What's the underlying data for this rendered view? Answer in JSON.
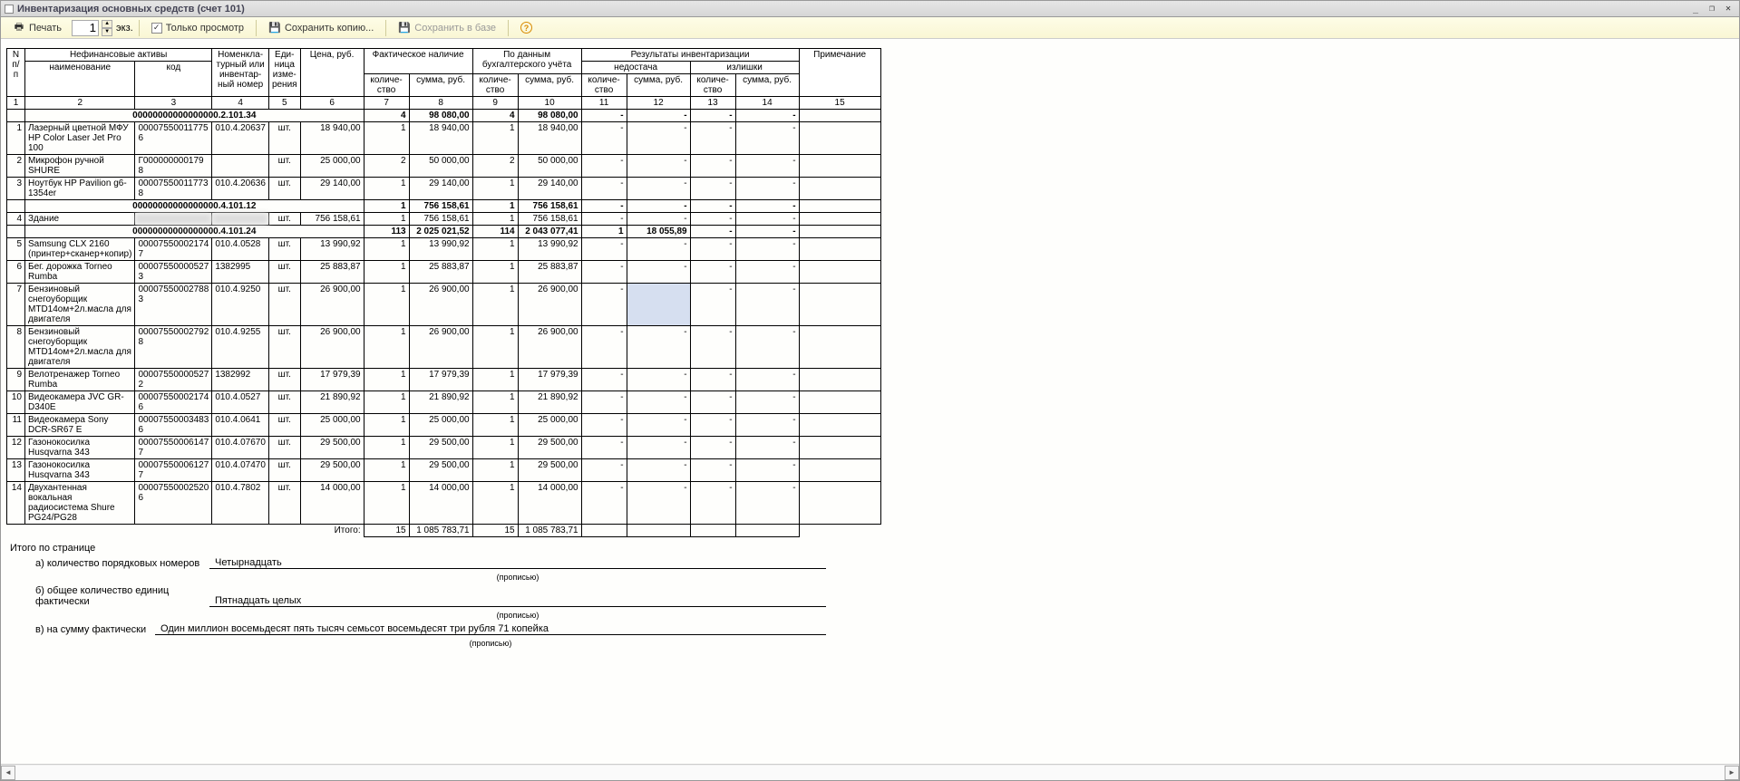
{
  "window": {
    "title": "Инвентаризация основных средств (счет 101)"
  },
  "toolbar": {
    "print": "Печать",
    "copies": "1",
    "copies_suffix": "экз.",
    "readonly": "Только просмотр",
    "readonly_checked": "✓",
    "save_copy": "Сохранить копию...",
    "save_db": "Сохранить в базе"
  },
  "headers": {
    "npp": "N п/п",
    "nfa": "Нефинансовые активы",
    "name": "наименование",
    "code": "код",
    "nomen": "Номенкла-\nтурный или инвентар-\nный номер",
    "unit": "Еди-\nница изме-\nрения",
    "price": "Цена, руб.",
    "fact": "Фактическое наличие",
    "book": "По данным бухгалтерского учёта",
    "result": "Результаты инвентаризации",
    "shortage": "недостача",
    "surplus": "излишки",
    "qty": "количе-\nство",
    "sum": "сумма, руб.",
    "note": "Примечание"
  },
  "colnums": [
    "1",
    "2",
    "3",
    "4",
    "5",
    "6",
    "7",
    "8",
    "9",
    "10",
    "11",
    "12",
    "13",
    "14",
    "15"
  ],
  "groups": [
    {
      "code": "00000000000000000.2.101.34",
      "fqty": "4",
      "fsum": "98 080,00",
      "bqty": "4",
      "bsum": "98 080,00",
      "rows": [
        {
          "n": "1",
          "name": "Лазерный цветной МФУ HP Color Laser Jet Pro 100",
          "code": "00007550011775 6",
          "inv": "010.4.20637",
          "unit": "шт.",
          "price": "18 940,00",
          "fq": "1",
          "fs": "18 940,00",
          "bq": "1",
          "bs": "18 940,00"
        },
        {
          "n": "2",
          "name": "Микрофон ручной SHURE",
          "code": "Г000000000179 8",
          "inv": "",
          "unit": "шт.",
          "price": "25 000,00",
          "fq": "2",
          "fs": "50 000,00",
          "bq": "2",
          "bs": "50 000,00"
        },
        {
          "n": "3",
          "name": "Ноутбук HP Pavilion g6-1354er",
          "code": "00007550011773 8",
          "inv": "010.4.20636",
          "unit": "шт.",
          "price": "29 140,00",
          "fq": "1",
          "fs": "29 140,00",
          "bq": "1",
          "bs": "29 140,00"
        }
      ]
    },
    {
      "code": "00000000000000000.4.101.12",
      "fqty": "1",
      "fsum": "756 158,61",
      "bqty": "1",
      "bsum": "756 158,61",
      "rows": [
        {
          "n": "4",
          "name": "Здание",
          "code": "",
          "inv": "",
          "unit": "шт.",
          "price": "756 158,61",
          "fq": "1",
          "fs": "756 158,61",
          "bq": "1",
          "bs": "756 158,61",
          "blur": true
        }
      ]
    },
    {
      "code": "00000000000000000.4.101.24",
      "fqty": "113",
      "fsum": "2 025 021,52",
      "bqty": "114",
      "bsum": "2 043 077,41",
      "shq": "1",
      "shs": "18 055,89",
      "rows": [
        {
          "n": "5",
          "name": "Samsung CLX 2160 (принтер+сканер+копир)",
          "code": "00007550002174 7",
          "inv": "010.4.0528",
          "unit": "шт.",
          "price": "13 990,92",
          "fq": "1",
          "fs": "13 990,92",
          "bq": "1",
          "bs": "13 990,92"
        },
        {
          "n": "6",
          "name": "Бег. дорожка Torneo Rumba",
          "code": "00007550000527 3",
          "inv": "1382995",
          "unit": "шт.",
          "price": "25 883,87",
          "fq": "1",
          "fs": "25 883,87",
          "bq": "1",
          "bs": "25 883,87"
        },
        {
          "n": "7",
          "name": "Бензиновый снегоуборщик MTD14ом+2л.масла для двигателя",
          "code": "00007550002788 3",
          "inv": "010.4.9250",
          "unit": "шт.",
          "price": "26 900,00",
          "fq": "1",
          "fs": "26 900,00",
          "bq": "1",
          "bs": "26 900,00",
          "sel": true
        },
        {
          "n": "8",
          "name": "Бензиновый снегоуборщик MTD14ом+2л.масла для двигателя",
          "code": "00007550002792 8",
          "inv": "010.4.9255",
          "unit": "шт.",
          "price": "26 900,00",
          "fq": "1",
          "fs": "26 900,00",
          "bq": "1",
          "bs": "26 900,00"
        },
        {
          "n": "9",
          "name": "Велотренажер Torneo Rumba",
          "code": "00007550000527 2",
          "inv": "1382992",
          "unit": "шт.",
          "price": "17 979,39",
          "fq": "1",
          "fs": "17 979,39",
          "bq": "1",
          "bs": "17 979,39"
        },
        {
          "n": "10",
          "name": "Видеокамера JVC GR-D340E",
          "code": "00007550002174 6",
          "inv": "010.4.0527",
          "unit": "шт.",
          "price": "21 890,92",
          "fq": "1",
          "fs": "21 890,92",
          "bq": "1",
          "bs": "21 890,92"
        },
        {
          "n": "11",
          "name": "Видеокамера Sony DCR-SR67 E",
          "code": "00007550003483 6",
          "inv": "010.4.0641",
          "unit": "шт.",
          "price": "25 000,00",
          "fq": "1",
          "fs": "25 000,00",
          "bq": "1",
          "bs": "25 000,00"
        },
        {
          "n": "12",
          "name": "Газонокосилка Husqvarna 343",
          "code": "00007550006147 7",
          "inv": "010.4.07670",
          "unit": "шт.",
          "price": "29 500,00",
          "fq": "1",
          "fs": "29 500,00",
          "bq": "1",
          "bs": "29 500,00"
        },
        {
          "n": "13",
          "name": "Газонокосилка Husqvarna 343",
          "code": "00007550006127 7",
          "inv": "010.4.07470",
          "unit": "шт.",
          "price": "29 500,00",
          "fq": "1",
          "fs": "29 500,00",
          "bq": "1",
          "bs": "29 500,00"
        },
        {
          "n": "14",
          "name": "Двухантенная вокальная радиосистема Shure PG24/PG28",
          "code": "00007550002520 6",
          "inv": "010.4.7802",
          "unit": "шт.",
          "price": "14 000,00",
          "fq": "1",
          "fs": "14 000,00",
          "bq": "1",
          "bs": "14 000,00"
        }
      ]
    }
  ],
  "totals": {
    "label": "Итого:",
    "fq": "15",
    "fs": "1 085 783,71",
    "bq": "15",
    "bs": "1 085 783,71"
  },
  "page_footer": {
    "title": "Итого по странице",
    "a_lbl": "а) количество порядковых номеров",
    "a_val": "Четырнадцать",
    "b_lbl": "б) общее количество единиц фактически",
    "b_val": "Пятнадцать целых",
    "v_lbl": "в) на сумму фактически",
    "v_val": "Один миллион восемьдесят пять тысяч семьсот восемьдесят три рубля 71 копейка",
    "caption": "(прописью)"
  }
}
